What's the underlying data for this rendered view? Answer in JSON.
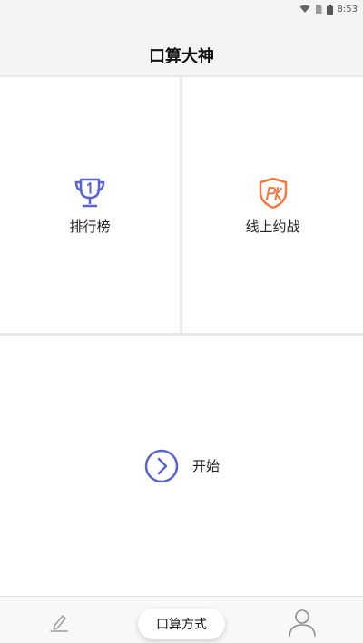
{
  "status_bar": {
    "time": "8:53",
    "icons": [
      "wifi-icon",
      "sim-icon",
      "battery-icon"
    ]
  },
  "header": {
    "title": "口算大神"
  },
  "menu": {
    "leaderboard": {
      "label": "排行榜",
      "icon": "trophy-icon"
    },
    "online_battle": {
      "label": "线上约战",
      "icon": "pk-shield-icon"
    },
    "start": {
      "label": "开始",
      "icon": "chevron-right-circle-icon"
    }
  },
  "tabbar": {
    "left_icon": "pencil-icon",
    "center_label": "口算方式",
    "right_icon": "user-icon"
  },
  "colors": {
    "accent_blue": "#5a62cf",
    "accent_orange": "#f2793f",
    "background": "#f4f4f6"
  }
}
